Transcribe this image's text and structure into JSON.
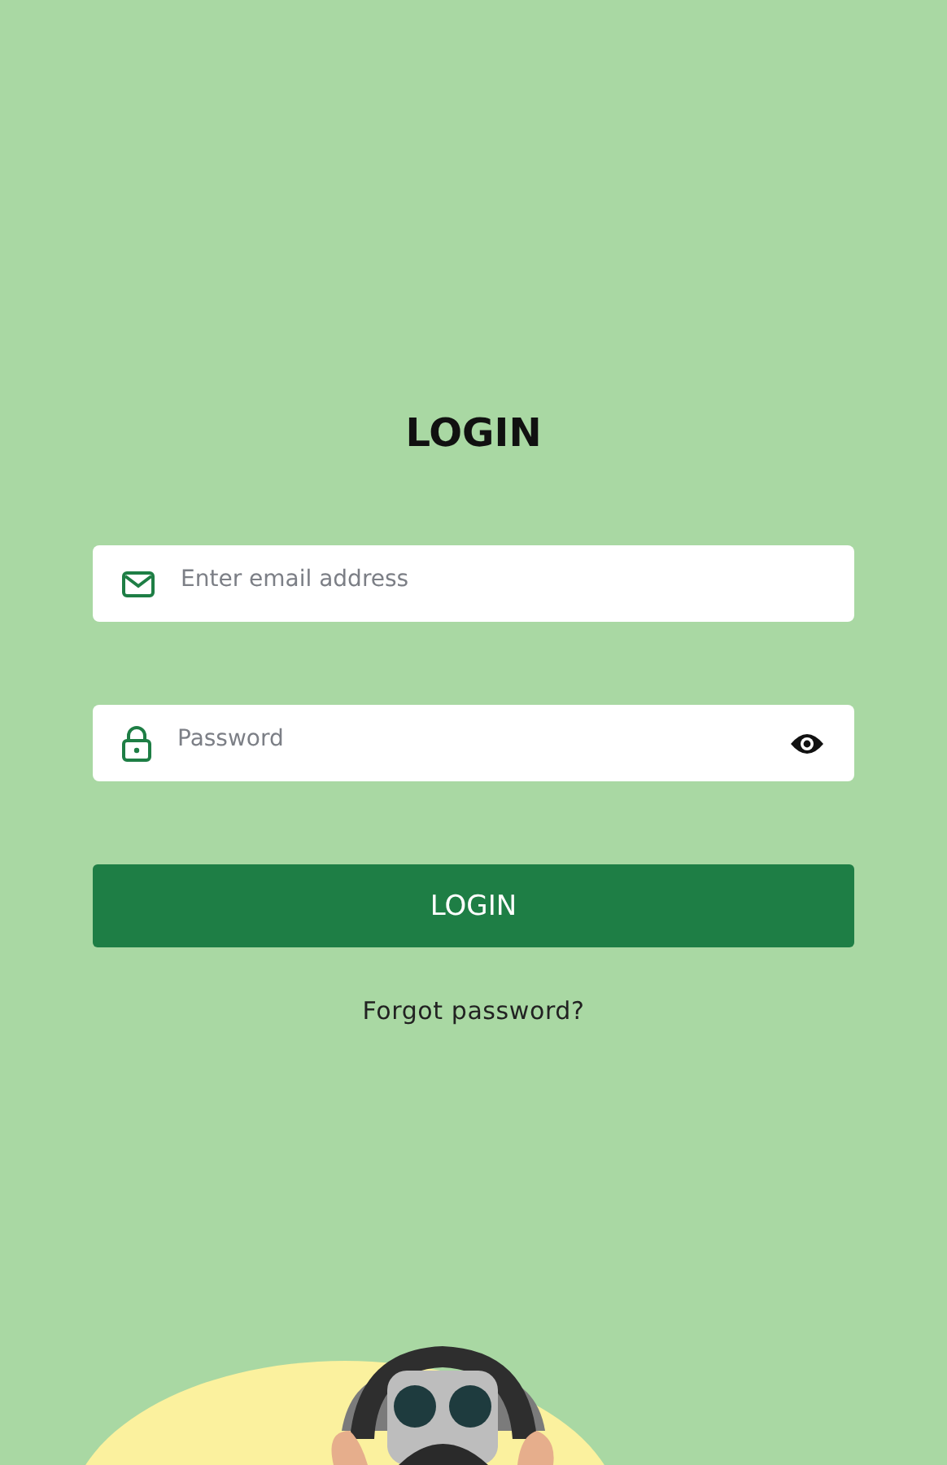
{
  "title": "LOGIN",
  "email_field": {
    "placeholder": "Enter email address"
  },
  "password_field": {
    "placeholder": "Password"
  },
  "login_button": "LOGIN",
  "forgot_link": "Forgot password?"
}
